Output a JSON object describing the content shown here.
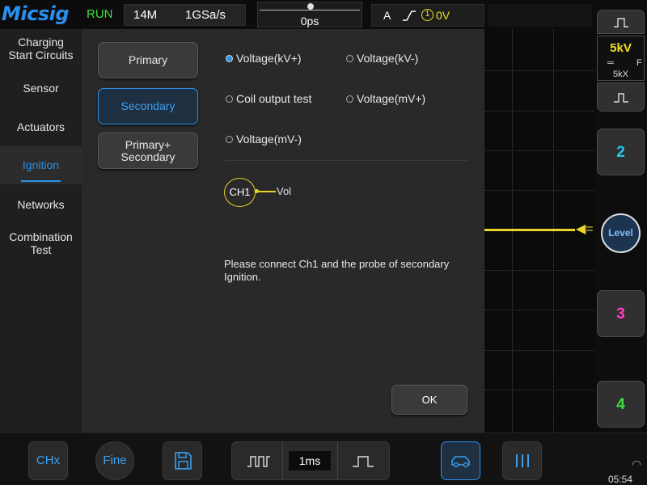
{
  "header": {
    "logo": "Micsig",
    "run_status": "RUN",
    "memory_depth": "14M",
    "sample_rate": "1GSa/s",
    "trigger_position": "0ps",
    "trigger": {
      "source": "A",
      "channel": "1",
      "level": "0V",
      "slope_icon": "rising-edge-icon"
    }
  },
  "sidebar": {
    "items": [
      {
        "label": "Charging\nStart Circuits"
      },
      {
        "label": "Sensor"
      },
      {
        "label": "Actuators"
      },
      {
        "label": "Ignition",
        "active": true
      },
      {
        "label": "Networks"
      },
      {
        "label": "Combination\nTest"
      }
    ]
  },
  "dialog": {
    "sub_buttons": [
      {
        "label": "Primary"
      },
      {
        "label": "Secondary",
        "selected": true
      },
      {
        "label": "Primary+\nSecondary"
      }
    ],
    "options": [
      {
        "label": "Voltage(kV+)",
        "checked": true
      },
      {
        "label": "Voltage(kV-)",
        "checked": false
      },
      {
        "label": "Coil output test",
        "checked": false
      },
      {
        "label": "Voltage(mV+)",
        "checked": false
      },
      {
        "label": "Voltage(mV-)",
        "checked": false
      }
    ],
    "channel_badge": "CH1",
    "channel_signal": "Vol",
    "message": "Please connect Ch1 and the probe of secondary Ignition.",
    "ok_label": "OK"
  },
  "right_panel": {
    "ch1_scale": "5kV",
    "ch1_coupling": "F",
    "ch1_probe": "5kX",
    "ch2_label": "2",
    "level_label": "Level",
    "ch3_label": "3",
    "ch4_label": "4",
    "colors": {
      "ch1": "#f0e020",
      "ch2": "#27c7f0",
      "ch3": "#ff3cc8",
      "ch4": "#3ee03e"
    }
  },
  "bottom_bar": {
    "chx_label": "CHx",
    "fine_label": "Fine",
    "timebase": "1ms",
    "clock": "05:54"
  }
}
